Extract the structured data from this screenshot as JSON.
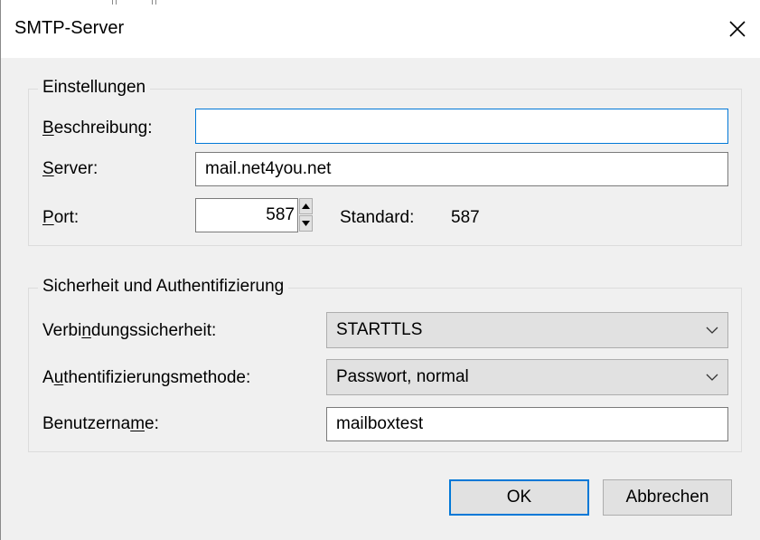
{
  "dialog": {
    "title": "SMTP-Server",
    "close_icon": "close-icon"
  },
  "settings": {
    "legend": "Einstellungen",
    "description": {
      "label_key": "B",
      "label_rest": "eschreibung:",
      "value": ""
    },
    "server": {
      "label_key": "S",
      "label_rest": "erver:",
      "value": "mail.net4you.net"
    },
    "port": {
      "label_key": "P",
      "label_rest": "ort:",
      "value": "587",
      "default_label": "Standard:",
      "default_value": "587"
    }
  },
  "security": {
    "legend": "Sicherheit und Authentifizierung",
    "connection": {
      "label_pre": "Verbi",
      "label_key": "n",
      "label_post": "dungssicherheit:",
      "selected": "STARTTLS"
    },
    "auth_method": {
      "label_pre": "A",
      "label_key": "u",
      "label_post": "thentifizierungsmethode:",
      "selected": "Passwort, normal"
    },
    "username": {
      "label_pre": "Benutzerna",
      "label_key": "m",
      "label_post": "e:",
      "value": "mailboxtest"
    }
  },
  "buttons": {
    "ok": "OK",
    "cancel": "Abbrechen"
  },
  "colors": {
    "accent": "#0078d7",
    "window_bg": "#f0f0f0",
    "button_bg": "#e1e1e1"
  }
}
